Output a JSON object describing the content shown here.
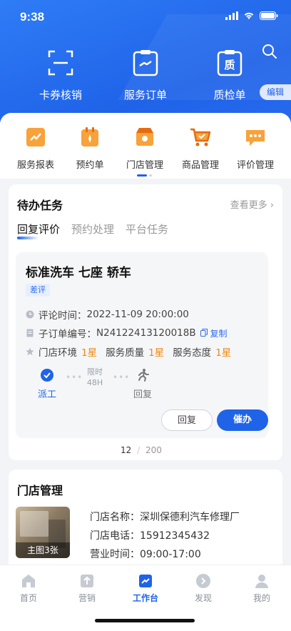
{
  "status": {
    "time": "9:38"
  },
  "top_actions": [
    {
      "label": "卡券核销",
      "icon": "scan-icon"
    },
    {
      "label": "服务订单",
      "icon": "order-icon"
    },
    {
      "label": "质检单",
      "icon": "quality-icon"
    }
  ],
  "quality_glyph": "质",
  "edit_label": "编辑",
  "quick_menu": [
    {
      "label": "服务报表",
      "icon": "report-icon"
    },
    {
      "label": "预约单",
      "icon": "booking-icon"
    },
    {
      "label": "门店管理",
      "icon": "store-icon"
    },
    {
      "label": "商品管理",
      "icon": "goods-icon"
    },
    {
      "label": "评价管理",
      "icon": "comment-icon"
    }
  ],
  "todo": {
    "title": "待办任务",
    "more": "查看更多",
    "tabs": [
      "回复评价",
      "预约处理",
      "平台任务"
    ],
    "task": {
      "title": "标准洗车 七座 轿车",
      "tag": "差评",
      "time_label": "评论时间：",
      "time_value": "2022-11-09 20:00:00",
      "order_label": "子订单编号：",
      "order_value": "N24122413120018B",
      "copy": "复制",
      "env_label": "门店环境",
      "env_value": "1星",
      "quality_label": "服务质量",
      "quality_value": "1星",
      "attitude_label": "服务态度",
      "attitude_value": "1星",
      "step1": "派工",
      "limit1": "限时",
      "limit2": "48H",
      "step2": "回复",
      "reply_btn": "回复",
      "urge_btn": "催办"
    },
    "page_current": "12",
    "page_sep": "/",
    "page_total": "200"
  },
  "store": {
    "title": "门店管理",
    "photo_label": "主图3张",
    "name_label": "门店名称：",
    "name_value": "深圳保德利汽车修理厂",
    "phone_label": "门店电话：",
    "phone_value": "15912345432",
    "hours_label": "营业时间：",
    "hours_value": "09:00-17:00"
  },
  "tabbar": [
    {
      "label": "首页",
      "icon": "home-icon"
    },
    {
      "label": "营销",
      "icon": "marketing-icon"
    },
    {
      "label": "工作台",
      "icon": "workbench-icon"
    },
    {
      "label": "发现",
      "icon": "discover-icon"
    },
    {
      "label": "我的",
      "icon": "profile-icon"
    }
  ],
  "colors": {
    "primary": "#1f63e8",
    "accent_orange": "#f08a12",
    "tag_bg": "#e6efff"
  }
}
